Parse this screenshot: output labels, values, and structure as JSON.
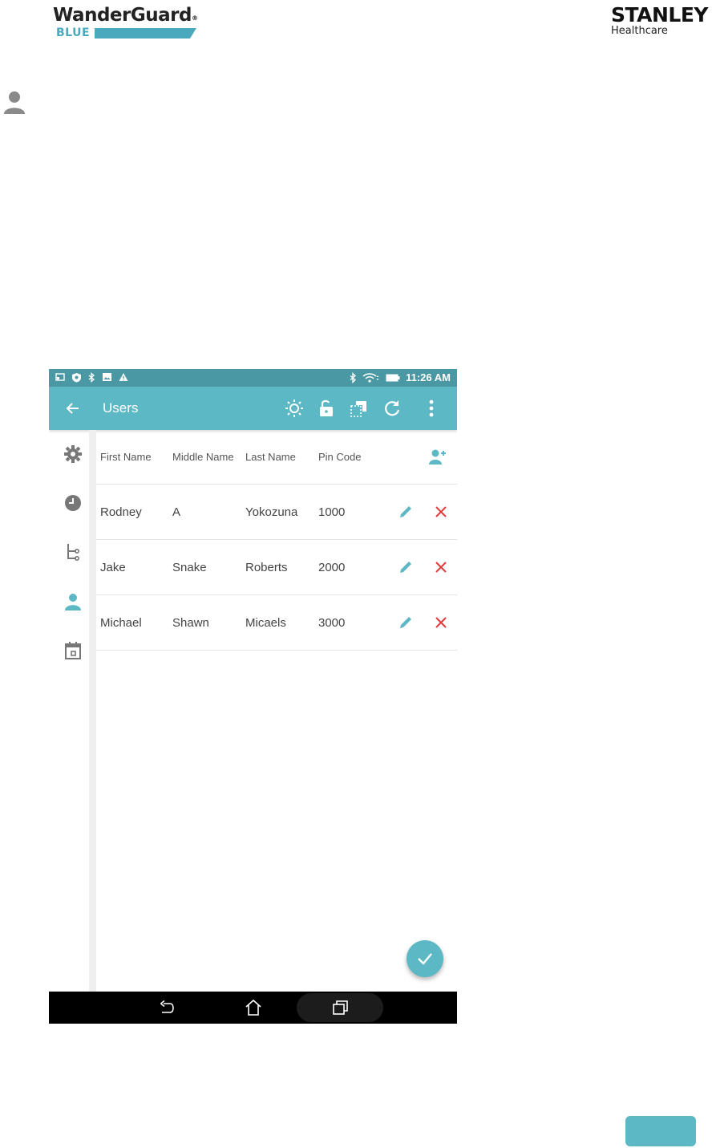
{
  "document": {
    "brand_left": {
      "name": "WanderGuard",
      "reg": "®",
      "sub": "BLUE"
    },
    "brand_right": {
      "name": "STANLEY",
      "sub": "Healthcare"
    },
    "colors": {
      "accent": "#5bb8c4",
      "status": "#4a98a3",
      "delete": "#e23b3b"
    }
  },
  "device": {
    "status_bar": {
      "time": "11:26 AM"
    },
    "app_bar": {
      "title": "Users"
    },
    "table": {
      "columns": [
        "First Name",
        "Middle Name",
        "Last Name",
        "Pin Code"
      ],
      "rows": [
        {
          "first": "Rodney",
          "middle": "A",
          "last": "Yokozuna",
          "pin": "1000"
        },
        {
          "first": "Jake",
          "middle": "Snake",
          "last": "Roberts",
          "pin": "2000"
        },
        {
          "first": "Michael",
          "middle": "Shawn",
          "last": "Micaels",
          "pin": "3000"
        }
      ]
    },
    "icons": {
      "toolbar": [
        "brightness-icon",
        "unlock-icon",
        "copy-icon",
        "refresh-icon",
        "more-vert-icon"
      ],
      "sidebar": [
        "settings-icon",
        "clock-icon",
        "tree-icon",
        "person-icon",
        "calendar-icon"
      ],
      "navbar": [
        "back-icon",
        "home-icon",
        "recent-apps-icon"
      ]
    }
  }
}
